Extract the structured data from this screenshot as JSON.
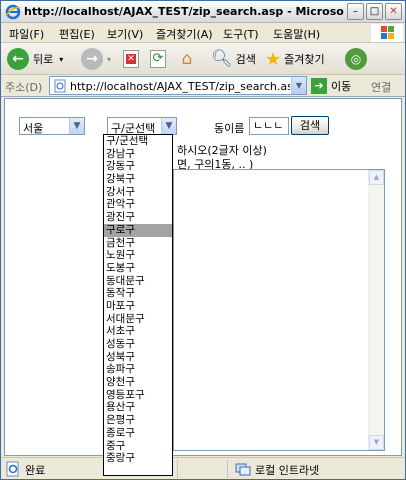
{
  "window": {
    "title": "http://localhost/AJAX_TEST/zip_search.asp - Microsoft Internet E...",
    "controls": [
      "0",
      "1",
      "r"
    ]
  },
  "menubar": {
    "items": [
      "파일(F)",
      "편집(E)",
      "보기(V)",
      "즐겨찾기(A)",
      "도구(T)",
      "도움말(H)"
    ]
  },
  "toolbar": {
    "back_label": "뒤로",
    "search_label": "검색",
    "favorites_label": "즐겨찾기"
  },
  "address": {
    "label": "주소(D)",
    "url": "http://localhost/AJAX_TEST/zip_search.asp",
    "go_label": "이동",
    "links_label": "연결"
  },
  "form": {
    "city_value": "서울",
    "district_value": "구/군선택",
    "dong_label": "동이름 :",
    "dong_value": "ㄴㄴㄴ",
    "search_button": "검색",
    "hint_line1": "하시오(2글자 이상)",
    "hint_line2": "면, 구의1동, .. )"
  },
  "dropdown": {
    "highlighted_index": 7,
    "options": [
      "구/군선택",
      "강남구",
      "강동구",
      "강북구",
      "강서구",
      "관악구",
      "광진구",
      "구로구",
      "금천구",
      "노원구",
      "도봉구",
      "동대문구",
      "동작구",
      "마포구",
      "서대문구",
      "서초구",
      "성동구",
      "성북구",
      "송파구",
      "양천구",
      "영등포구",
      "용산구",
      "은평구",
      "종로구",
      "중구",
      "중랑구"
    ]
  },
  "statusbar": {
    "status_text": "완료",
    "zone_text": "로컬 인트라넷"
  },
  "colors": {
    "titlebar": "#e8e8e8",
    "border": "#7f9db9",
    "highlight": "#a3a3a3",
    "back_green": "#3aa23a",
    "stop_red": "#d9322c"
  }
}
